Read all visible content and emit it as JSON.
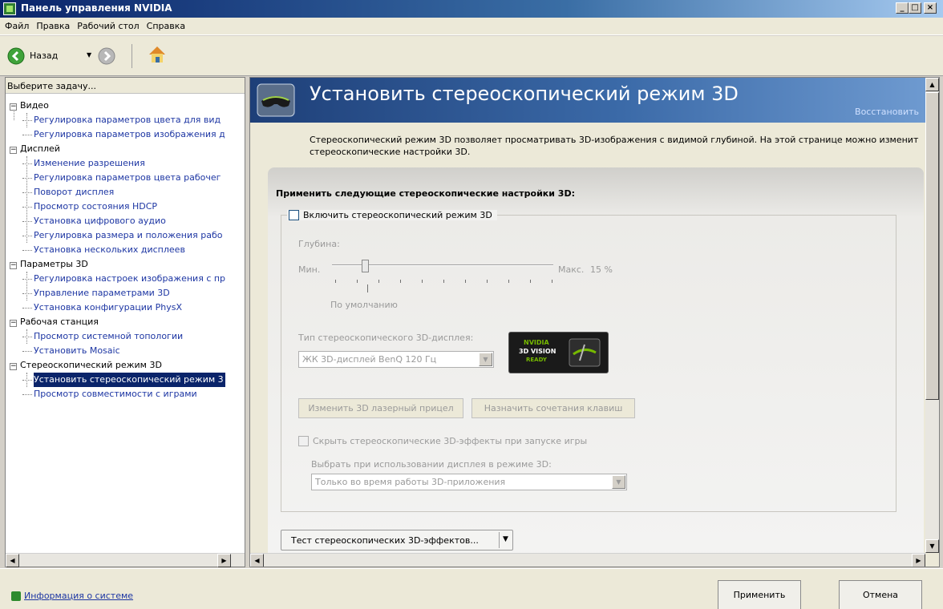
{
  "window": {
    "title": "Панель управления NVIDIA"
  },
  "menu": [
    "Файл",
    "Правка",
    "Рабочий стол",
    "Справка"
  ],
  "toolbar": {
    "back_label": "Назад"
  },
  "left": {
    "header": "Выберите задачу...",
    "tree": [
      {
        "label": "Видео",
        "items": [
          "Регулировка параметров цвета для вид",
          "Регулировка параметров изображения д"
        ]
      },
      {
        "label": "Дисплей",
        "items": [
          "Изменение разрешения",
          "Регулировка параметров цвета рабочег",
          "Поворот дисплея",
          "Просмотр состояния HDCP",
          "Установка цифрового аудио",
          "Регулировка размера и положения рабо",
          "Установка нескольких дисплеев"
        ]
      },
      {
        "label": "Параметры 3D",
        "items": [
          "Регулировка настроек изображения с пр",
          "Управление параметрами 3D",
          "Установка конфигурации PhysX"
        ]
      },
      {
        "label": "Рабочая станция",
        "items": [
          "Просмотр системной топологии",
          "Установить Mosaic"
        ]
      },
      {
        "label": "Стереоскопический режим 3D",
        "items": [
          "Установить стереоскопический режим 3",
          "Просмотр совместимости с играми"
        ]
      }
    ],
    "selected": "Установить стереоскопический режим 3"
  },
  "page": {
    "title": "Установить стереоскопический режим 3D",
    "restore": "Восстановить",
    "description_1": "Стереоскопический режим 3D позволяет просматривать 3D-изображения с видимой глубиной. На этой странице можно изменит",
    "description_2": "стереоскопические настройки 3D.",
    "apply_label": "Применить следующие стереоскопические настройки 3D:",
    "enable_label": "Включить стереоскопический режим 3D",
    "enable_checked": false,
    "depth_label": "Глубина:",
    "min_label": "Мин.",
    "max_label": "Макс.",
    "depth_value": "15 %",
    "depth_fraction": 0.15,
    "default_label": "По умолчанию",
    "display_type_label": "Тип стереоскопического 3D-дисплея:",
    "display_type_value": "ЖК 3D-дисплей BenQ 120 Гц",
    "logo": {
      "brand": "NVIDIA",
      "line1": "3D VISION",
      "line2": "READY"
    },
    "laser_button": "Изменить 3D лазерный прицел",
    "hotkeys_button": "Назначить сочетания клавиш",
    "hide_effects_label": "Скрыть стереоскопические 3D-эффекты при запуске игры",
    "display_mode_label": "Выбрать при использовании дисплея в режиме 3D:",
    "display_mode_value": "Только во время работы 3D-приложения",
    "test_button": "Тест стереоскопических 3D-эффектов..."
  },
  "status": {
    "sysinfo": "Информация о системе",
    "apply": "Применить",
    "cancel": "Отмена"
  },
  "colors": {
    "banner": "#1e3f78",
    "selection": "#0a246a",
    "link": "#1d36a3"
  }
}
